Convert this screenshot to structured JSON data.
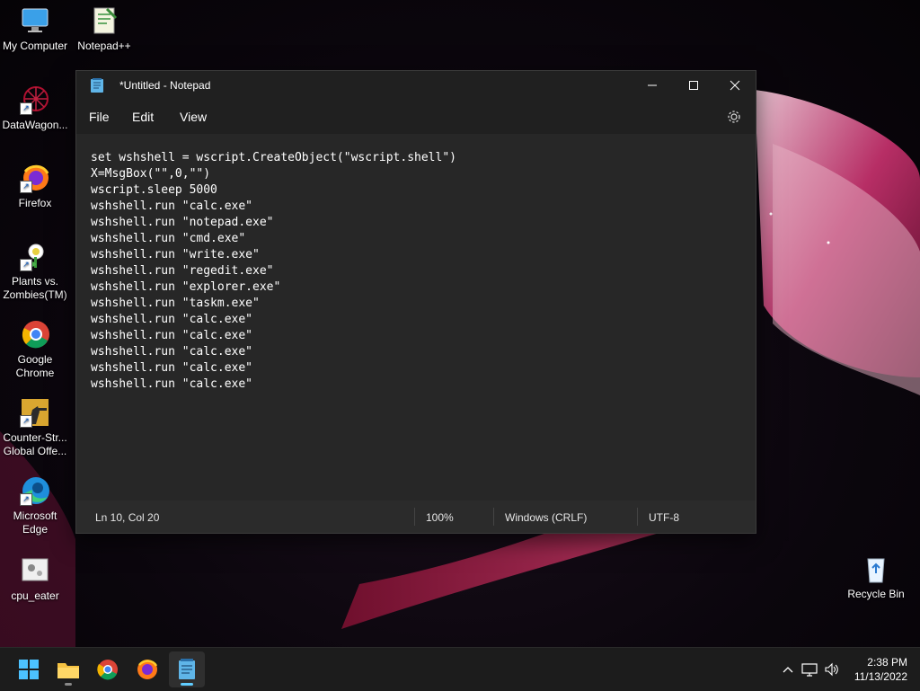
{
  "colors": {
    "accent": "#60cdff",
    "window_bg": "#272727",
    "titlebar_bg": "#202020",
    "taskbar_bg": "#1c1c1c"
  },
  "desktop": {
    "icons": [
      {
        "label": "My Computer",
        "icon": "monitor-icon"
      },
      {
        "label": "Notepad++",
        "icon": "notepadpp-icon"
      },
      {
        "label": "DataWagon...",
        "icon": "datawagon-icon"
      },
      {
        "label": "Firefox",
        "icon": "firefox-icon"
      },
      {
        "label": "Plants vs. Zombies(TM)",
        "icon": "pvz-icon"
      },
      {
        "label": "Google Chrome",
        "icon": "chrome-icon"
      },
      {
        "label": "Counter-Str... Global Offe...",
        "icon": "csgo-icon"
      },
      {
        "label": "Microsoft Edge",
        "icon": "edge-icon"
      },
      {
        "label": "cpu_eater",
        "icon": "script-file-icon"
      },
      {
        "label": "Recycle Bin",
        "icon": "recycle-bin-icon"
      }
    ]
  },
  "notepad": {
    "title": "*Untitled - Notepad",
    "menu": {
      "file": "File",
      "edit": "Edit",
      "view": "View"
    },
    "content": "set wshshell = wscript.CreateObject(\"wscript.shell\")\nX=MsgBox(\"\",0,\"\")\nwscript.sleep 5000\nwshshell.run \"calc.exe\"\nwshshell.run \"notepad.exe\"\nwshshell.run \"cmd.exe\"\nwshshell.run \"write.exe\"\nwshshell.run \"regedit.exe\"\nwshshell.run \"explorer.exe\"\nwshshell.run \"taskm.exe\"\nwshshell.run \"calc.exe\"\nwshshell.run \"calc.exe\"\nwshshell.run \"calc.exe\"\nwshshell.run \"calc.exe\"\nwshshell.run \"calc.exe\"",
    "status": {
      "position": "Ln 10, Col 20",
      "zoom": "100%",
      "line_ending": "Windows (CRLF)",
      "encoding": "UTF-8"
    }
  },
  "taskbar": {
    "apps": [
      "start-icon",
      "file-explorer-icon",
      "chrome-icon",
      "firefox-icon",
      "notepad-icon"
    ],
    "clock": {
      "time": "2:38 PM",
      "date": "11/13/2022"
    }
  }
}
